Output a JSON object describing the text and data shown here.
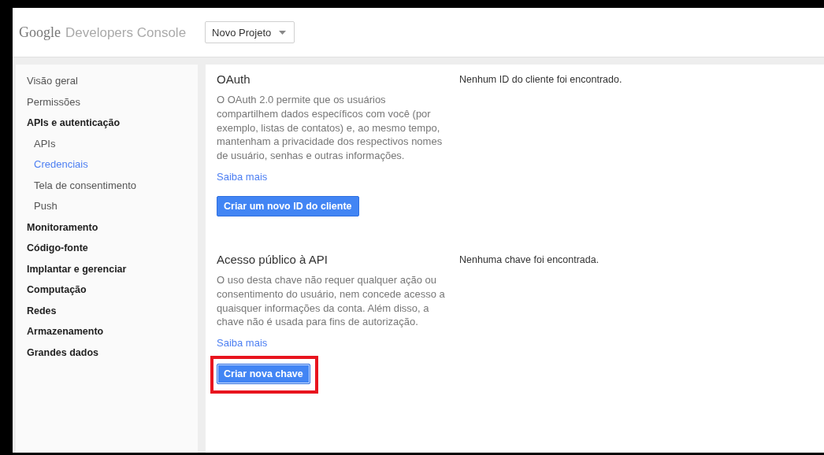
{
  "header": {
    "logo": "Google",
    "product": "Developers Console",
    "project_dropdown": "Novo Projeto"
  },
  "sidebar": {
    "items": [
      {
        "label": "Visão geral",
        "kind": "link",
        "selected": false
      },
      {
        "label": "Permissões",
        "kind": "link",
        "selected": false
      },
      {
        "label": "APIs e autenticação",
        "kind": "group",
        "selected": false,
        "children": [
          {
            "label": "APIs",
            "selected": false
          },
          {
            "label": "Credenciais",
            "selected": true
          },
          {
            "label": "Tela de consentimento",
            "selected": false
          },
          {
            "label": "Push",
            "selected": false
          }
        ]
      },
      {
        "label": "Monitoramento",
        "kind": "group",
        "selected": false
      },
      {
        "label": "Código-fonte",
        "kind": "group",
        "selected": false
      },
      {
        "label": "Implantar e gerenciar",
        "kind": "group",
        "selected": false
      },
      {
        "label": "Computação",
        "kind": "group",
        "selected": false
      },
      {
        "label": "Redes",
        "kind": "group",
        "selected": false
      },
      {
        "label": "Armazenamento",
        "kind": "group",
        "selected": false
      },
      {
        "label": "Grandes dados",
        "kind": "group",
        "selected": false
      }
    ]
  },
  "sections": [
    {
      "title": "OAuth",
      "description": "O OAuth 2.0 permite que os usuários compartilhem dados específicos com você (por exemplo, listas de contatos) e, ao mesmo tempo, mantenham a privacidade dos respectivos nomes de usuário, senhas e outras informações.",
      "link": "Saiba mais",
      "button": {
        "label": "Criar um novo ID do cliente",
        "highlighted": false
      },
      "status": "Nenhum ID do cliente foi encontrado."
    },
    {
      "title": "Acesso público à API",
      "description": "O uso desta chave não requer qualquer ação ou consentimento do usuário, nem concede acesso a quaisquer informações da conta. Além disso, a chave não é usada para fins de autorização.",
      "link": "Saiba mais",
      "button": {
        "label": "Criar nova chave",
        "highlighted": true
      },
      "status": "Nenhuma chave foi encontrada."
    }
  ]
}
